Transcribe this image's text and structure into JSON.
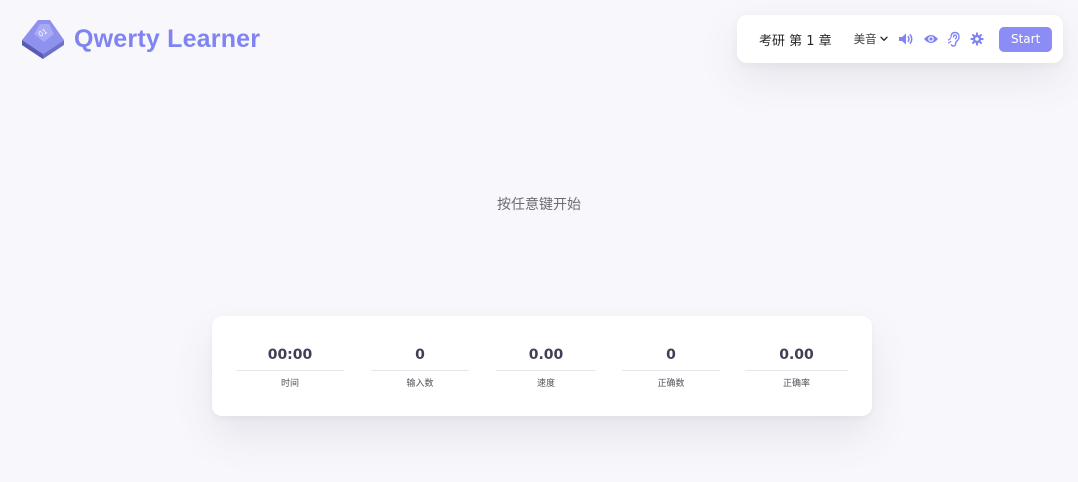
{
  "app": {
    "title": "Qwerty Learner",
    "logo_icon": "keyboard-key-icon",
    "accent_color": "#8084f2"
  },
  "toolbar": {
    "dictionary_label": "考研 第 1 章",
    "accent_label": "美音",
    "icons": [
      "volume-icon",
      "eye-icon",
      "ear-icon",
      "gear-icon"
    ],
    "start_label": "Start",
    "start_color": "#8b8cf6"
  },
  "main": {
    "hint": "按任意键开始"
  },
  "stats": {
    "items": [
      {
        "value": "00:00",
        "label": "时间"
      },
      {
        "value": "0",
        "label": "输入数"
      },
      {
        "value": "0.00",
        "label": "速度"
      },
      {
        "value": "0",
        "label": "正确数"
      },
      {
        "value": "0.00",
        "label": "正确率"
      }
    ]
  }
}
